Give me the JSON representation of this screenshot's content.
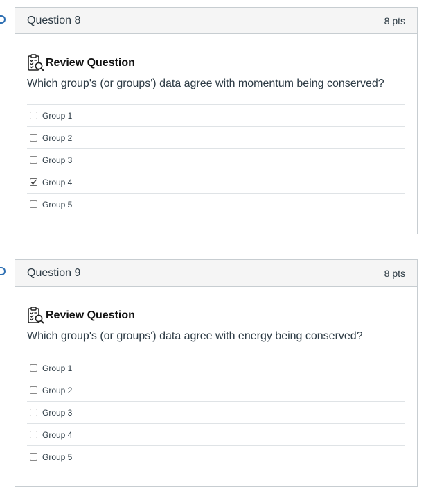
{
  "questions": [
    {
      "title": "Question 8",
      "points": "8 pts",
      "review_label": "Review Question",
      "review_icon": "clipboard-search-icon",
      "text": "Which group's (or groups') data agree with momentum being conserved?",
      "answers": [
        {
          "label": "Group 1",
          "checked": false
        },
        {
          "label": "Group 2",
          "checked": false
        },
        {
          "label": "Group 3",
          "checked": false
        },
        {
          "label": "Group 4",
          "checked": true
        },
        {
          "label": "Group 5",
          "checked": false
        }
      ]
    },
    {
      "title": "Question 9",
      "points": "8 pts",
      "review_label": "Review Question",
      "review_icon": "clipboard-search-icon",
      "text": "Which group's (or groups') data agree with energy being conserved?",
      "answers": [
        {
          "label": "Group 1",
          "checked": false
        },
        {
          "label": "Group 2",
          "checked": false
        },
        {
          "label": "Group 3",
          "checked": false
        },
        {
          "label": "Group 4",
          "checked": false
        },
        {
          "label": "Group 5",
          "checked": false
        }
      ]
    }
  ],
  "colors": {
    "accent": "#2d6fb3",
    "header_bg": "#f5f5f5",
    "border": "#c7cdd1",
    "text": "#2d3b45"
  }
}
